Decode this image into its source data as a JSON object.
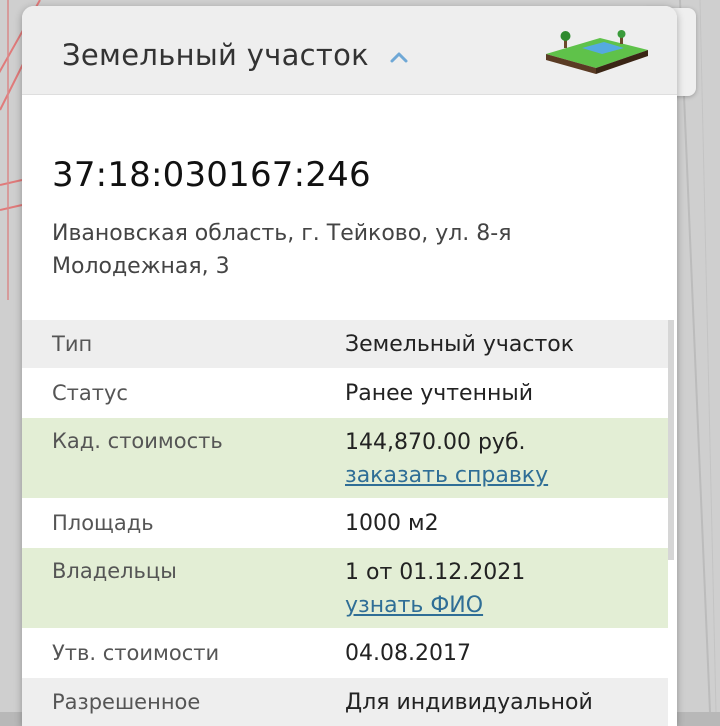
{
  "header": {
    "title": "Земельный участок"
  },
  "plot": {
    "cadastral_number": "37:18:030167:246",
    "address": "Ивановская область, г. Тейково, ул. 8-я Молодежная, 3"
  },
  "details": [
    {
      "key": "Тип",
      "value": "Земельный участок"
    },
    {
      "key": "Статус",
      "value": "Ранее учтенный"
    },
    {
      "key": "Кад. стоимость",
      "value": "144,870.00 руб.",
      "link": "заказать справку"
    },
    {
      "key": "Площадь",
      "value": "1000 м2"
    },
    {
      "key": "Владельцы",
      "value": "1 от 01.12.2021",
      "link": "узнать ФИО"
    },
    {
      "key": "Утв. стоимости",
      "value": "04.08.2017"
    },
    {
      "key": "Разрешенное",
      "value": "Для индивидуальной"
    }
  ],
  "colors": {
    "green_row": "#e3eed5",
    "gray_row": "#eeeeee",
    "link": "#2f6e96",
    "chevron": "#6fa8d6"
  },
  "icons": {
    "chevron": "chevron-up-icon",
    "land": "land-plot-icon"
  }
}
